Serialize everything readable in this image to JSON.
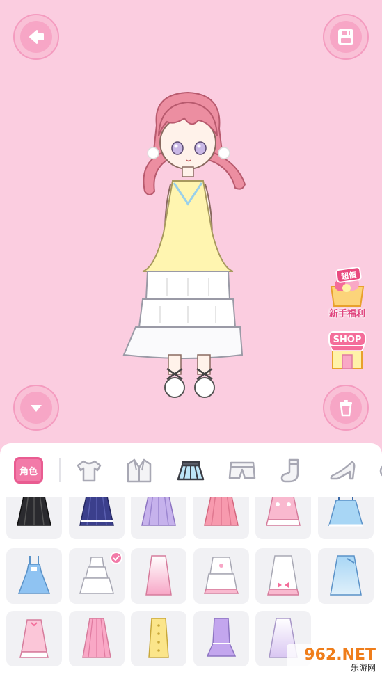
{
  "promos": {
    "welfare_badge": "超值",
    "welfare_label": "新手福利",
    "shop_label": "SHOP"
  },
  "tabs": {
    "role_label": "角色",
    "items": [
      "shirt-icon",
      "jacket-icon",
      "skirt-icon",
      "shorts-icon",
      "sock-icon",
      "shoe-icon"
    ]
  },
  "selected_item": "skirt-white-tiered",
  "watermark": {
    "brand": "962.NET",
    "subtitle": "乐游网"
  },
  "colors": {
    "background": "#fbcde0",
    "accent": "#f27aa8",
    "card": "#f1f1f4"
  }
}
